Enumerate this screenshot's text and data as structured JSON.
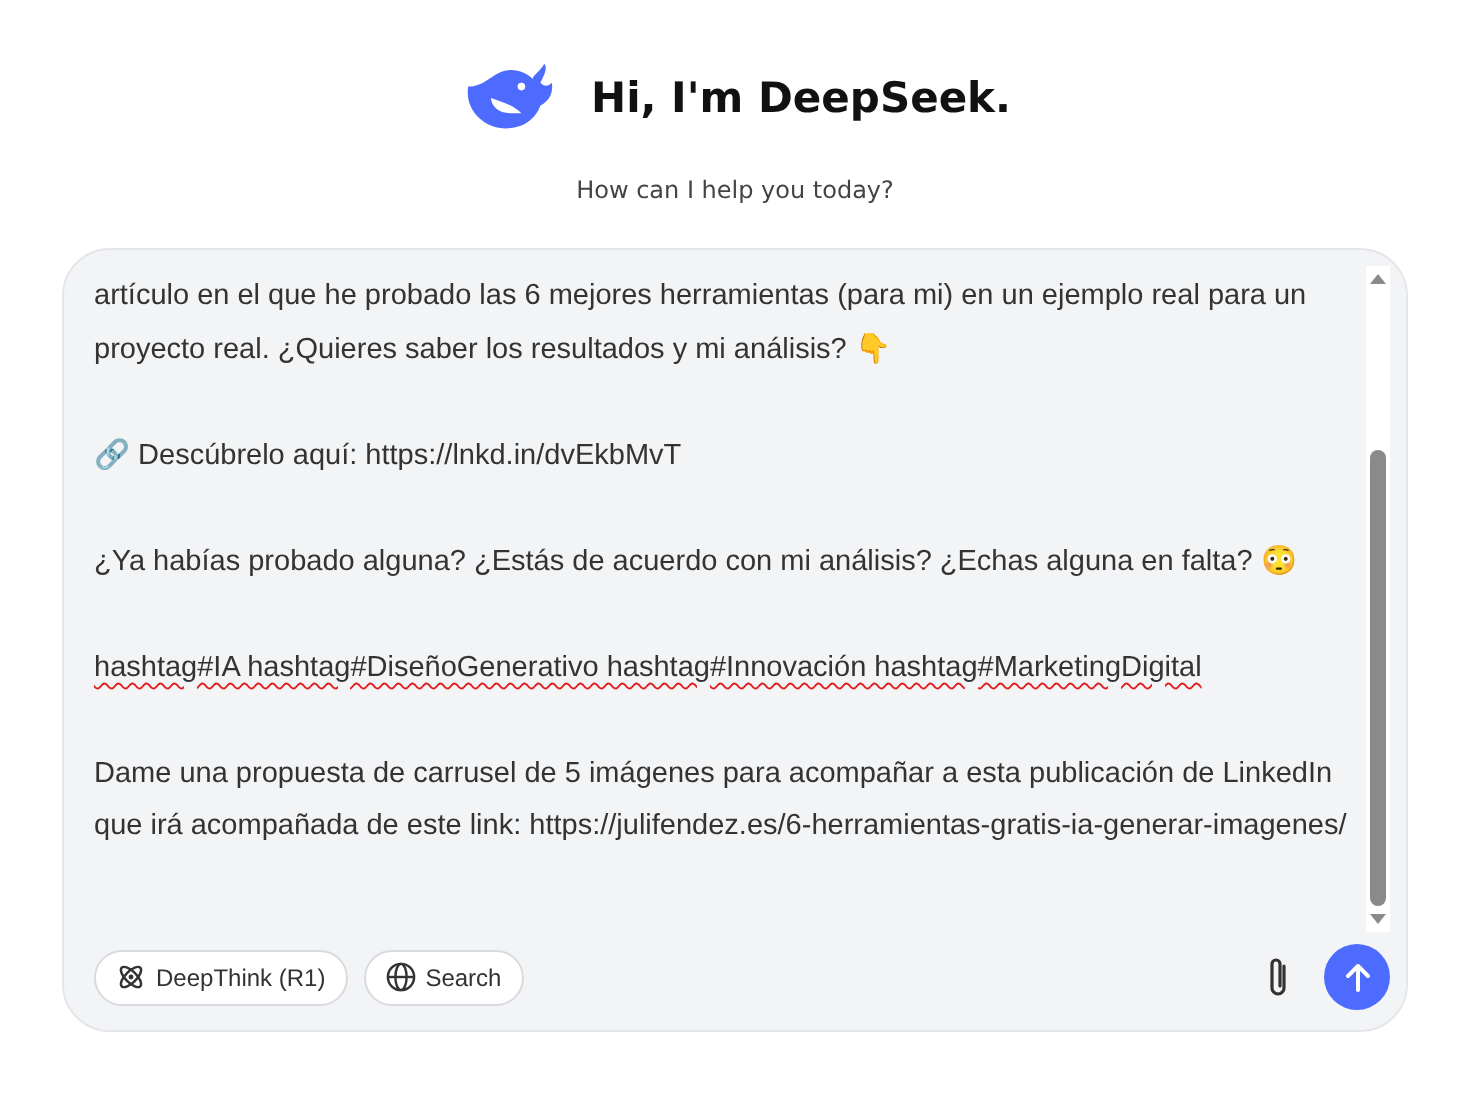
{
  "header": {
    "title": "Hi, I'm DeepSeek.",
    "subtitle": "How can I help you today?"
  },
  "composer": {
    "paragraphs": [
      {
        "text": "artículo en el que he probado las 6 mejores herramientas (para mi) en un ejemplo real para un proyecto real. ¿Quieres saber los resultados y mi análisis? 👇",
        "flagged": false
      },
      {
        "text": "🔗 Descúbrelo aquí: https://lnkd.in/dvEkbMvT",
        "flagged": false
      },
      {
        "text": "¿Ya habías probado alguna? ¿Estás de acuerdo con mi análisis? ¿Echas alguna en falta? 😳",
        "flagged": false
      },
      {
        "text": "hashtag#IA hashtag#DiseñoGenerativo hashtag#Innovación hashtag#MarketingDigital",
        "flagged": true
      },
      {
        "text": "Dame una propuesta de carrusel de 5 imágenes para acompañar a esta publicación de LinkedIn que irá acompañada de este link: https://julifendez.es/6-herramientas-gratis-ia-generar-imagenes/",
        "flagged": false
      }
    ],
    "toggles": [
      {
        "label": "DeepThink (R1)",
        "kind": "deepthink",
        "selected": false
      },
      {
        "label": "Search",
        "kind": "search",
        "selected": false
      }
    ]
  }
}
